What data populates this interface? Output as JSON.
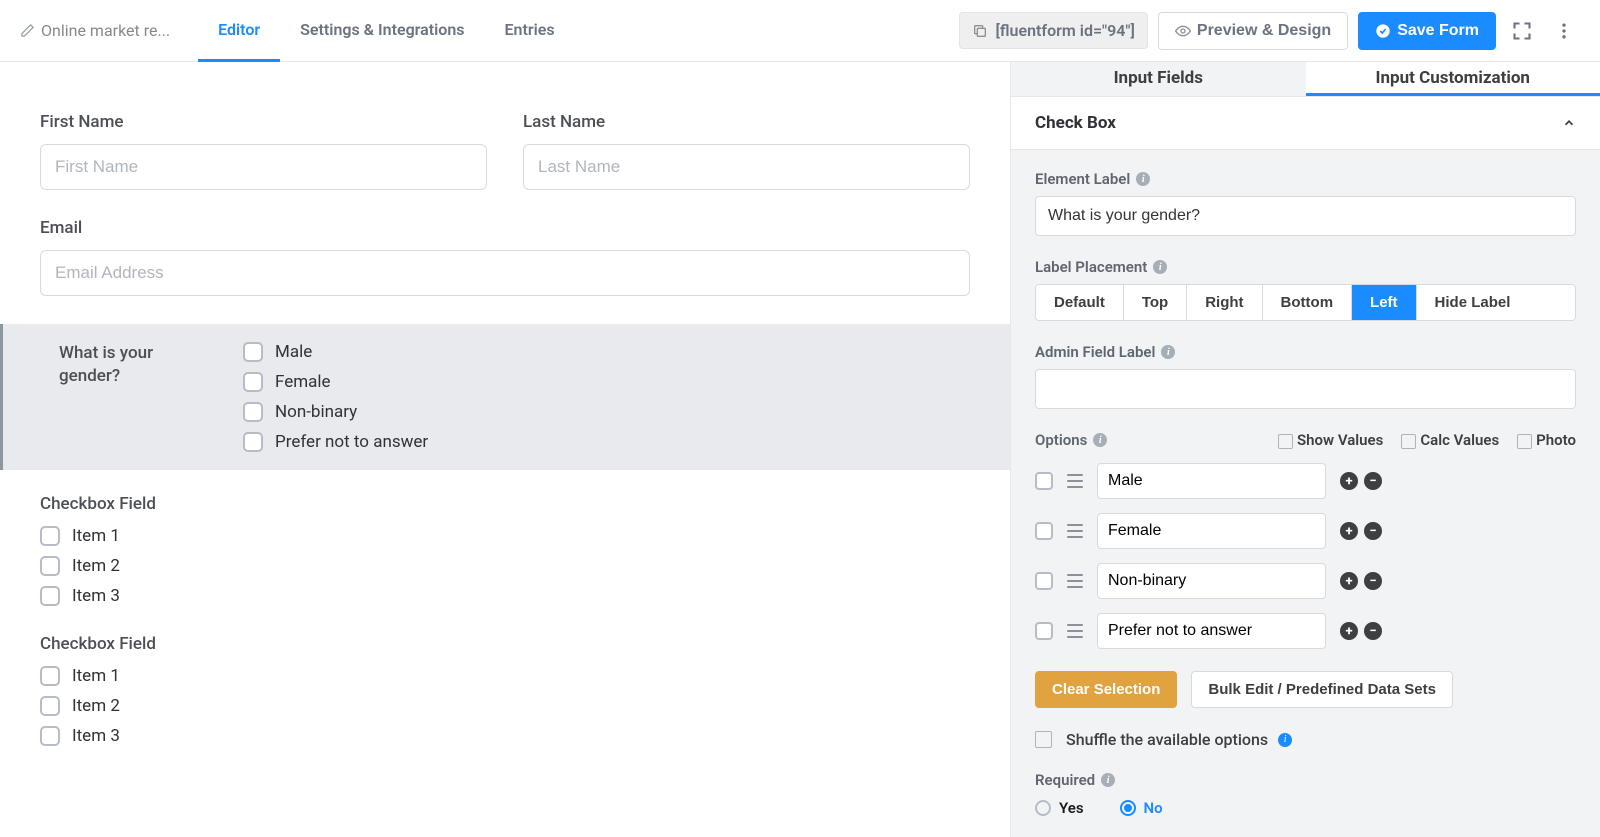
{
  "header": {
    "form_title": "Online market re...",
    "tabs": {
      "editor": "Editor",
      "settings": "Settings & Integrations",
      "entries": "Entries"
    },
    "shortcode": "[fluentform id=\"94\"]",
    "preview": "Preview & Design",
    "save": "Save Form"
  },
  "canvas": {
    "first_name": {
      "label": "First Name",
      "placeholder": "First Name"
    },
    "last_name": {
      "label": "Last Name",
      "placeholder": "Last Name"
    },
    "email": {
      "label": "Email",
      "placeholder": "Email Address"
    },
    "gender": {
      "label": "What is your gender?",
      "options": [
        "Male",
        "Female",
        "Non-binary",
        "Prefer not to answer"
      ]
    },
    "cb1": {
      "label": "Checkbox Field",
      "options": [
        "Item 1",
        "Item 2",
        "Item 3"
      ]
    },
    "cb2": {
      "label": "Checkbox Field",
      "options": [
        "Item 1",
        "Item 2",
        "Item 3"
      ]
    }
  },
  "sidebar": {
    "tabs": {
      "input_fields": "Input Fields",
      "customization": "Input Customization"
    },
    "section_title": "Check Box",
    "element_label": {
      "label": "Element Label",
      "value": "What is your gender?"
    },
    "label_placement": {
      "label": "Label Placement",
      "options": [
        "Default",
        "Top",
        "Right",
        "Bottom",
        "Left",
        "Hide Label"
      ],
      "active": "Left"
    },
    "admin_field_label": {
      "label": "Admin Field Label",
      "value": ""
    },
    "options": {
      "label": "Options",
      "show_values": "Show Values",
      "calc_values": "Calc Values",
      "photo": "Photo",
      "items": [
        "Male",
        "Female",
        "Non-binary",
        "Prefer not to answer"
      ]
    },
    "clear_selection": "Clear Selection",
    "bulk_edit": "Bulk Edit / Predefined Data Sets",
    "shuffle": "Shuffle the available options",
    "required": {
      "label": "Required",
      "yes": "Yes",
      "no": "No",
      "value": "No"
    }
  }
}
